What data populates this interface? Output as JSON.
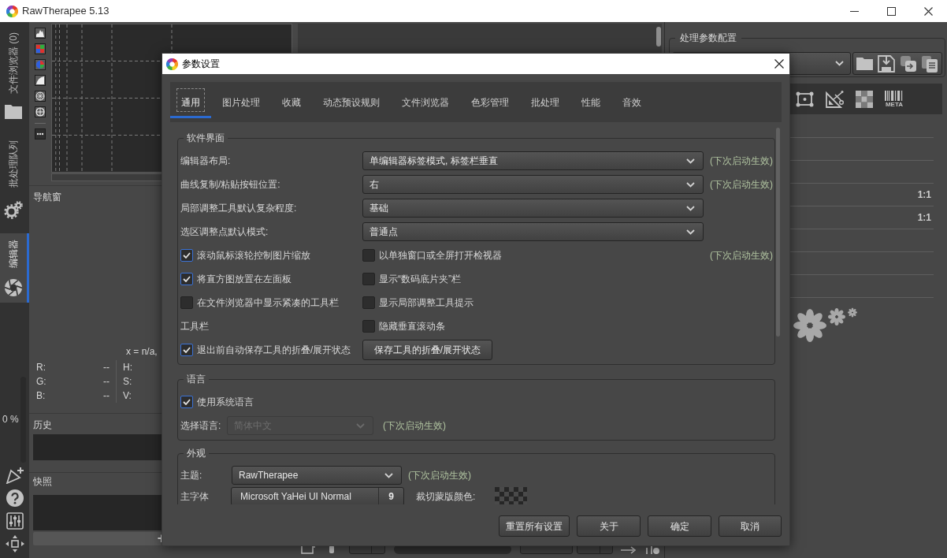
{
  "window": {
    "title": "RawTherapee 5.13"
  },
  "side_tabs": [
    {
      "label": "文件浏览器 (0)",
      "selected": false
    },
    {
      "label": "批处理队列",
      "selected": false
    },
    {
      "label": "编辑器",
      "selected": true
    }
  ],
  "queue_progress": {
    "label": "0 %"
  },
  "left_panel": {
    "navigator": {
      "title": "导航窗",
      "position": "x = n/a,",
      "rgb": [
        {
          "label": "R:",
          "value": "--"
        },
        {
          "label": "G:",
          "value": "--"
        },
        {
          "label": "B:",
          "value": "--"
        }
      ],
      "hsv": [
        {
          "label": "H:"
        },
        {
          "label": "S:"
        },
        {
          "label": "V:"
        }
      ]
    },
    "history": {
      "title": "历史"
    },
    "snapshots": {
      "title": "快照",
      "add_button": "+"
    }
  },
  "right_panel": {
    "profile": {
      "title": "处理参数配置"
    },
    "toolbar": {
      "metadata_label": "META"
    },
    "tool_rows": [
      {
        "kind": "blank"
      },
      {
        "kind": "blank"
      },
      {
        "kind": "blank"
      },
      {
        "kind": "ratio",
        "value": "1:1"
      },
      {
        "kind": "ratio",
        "value": "1:1"
      },
      {
        "kind": "blank"
      },
      {
        "kind": "blank"
      },
      {
        "kind": "blank"
      }
    ]
  },
  "dialog": {
    "title": "参数设置",
    "tabs": [
      {
        "label": "通用",
        "selected": true
      },
      {
        "label": "图片处理",
        "selected": false
      },
      {
        "label": "收藏",
        "selected": false
      },
      {
        "label": "动态预设规则",
        "selected": false
      },
      {
        "label": "文件浏览器",
        "selected": false
      },
      {
        "label": "色彩管理",
        "selected": false
      },
      {
        "label": "批处理",
        "selected": false
      },
      {
        "label": "性能",
        "selected": false
      },
      {
        "label": "音效",
        "selected": false
      }
    ],
    "sections": [
      {
        "title": "软件界面",
        "rows": [
          {
            "kind": "combo",
            "label": "编辑器布局:",
            "value": "单编辑器标签模式, 标签栏垂直",
            "disabled": false,
            "note": "(下次启动生效)"
          },
          {
            "kind": "combo",
            "label": "曲线复制/粘贴按钮位置:",
            "value": "右",
            "disabled": false,
            "note": "(下次启动生效)"
          },
          {
            "kind": "combo",
            "label": "局部调整工具默认复杂程度:",
            "value": "基础",
            "disabled": false
          },
          {
            "kind": "combo",
            "label": "选区调整点默认模式:",
            "value": "普通点",
            "disabled": false
          },
          {
            "kind": "pair",
            "left": {
              "kind": "checkbox",
              "label": "滚动鼠标滚轮控制图片缩放",
              "checked": true
            },
            "right": {
              "kind": "checkbox",
              "label": "以单独窗口或全屏打开检视器",
              "checked": false
            },
            "note": "(下次启动生效)"
          },
          {
            "kind": "pair",
            "left": {
              "kind": "checkbox",
              "label": "将直方图放置在左面板",
              "checked": true
            },
            "right": {
              "kind": "checkbox",
              "label": "显示“数码底片夹”栏",
              "checked": false
            }
          },
          {
            "kind": "pair",
            "left": {
              "kind": "checkbox",
              "label": "在文件浏览器中显示紧凑的工具栏",
              "checked": false
            },
            "right": {
              "kind": "checkbox",
              "label": "显示局部调整工具提示",
              "checked": false
            }
          },
          {
            "kind": "pair",
            "left": {
              "kind": "text",
              "label": "工具栏"
            },
            "right": {
              "kind": "checkbox",
              "label": "隐藏垂直滚动条",
              "checked": false
            }
          },
          {
            "kind": "pair",
            "left": {
              "kind": "checkbox",
              "label": "退出前自动保存工具的折叠/展开状态",
              "checked": true
            },
            "right": {
              "kind": "button",
              "label": "保存工具的折叠/展开状态"
            }
          }
        ]
      },
      {
        "title": "语言",
        "rows": [
          {
            "kind": "pair",
            "left": {
              "kind": "checkbox",
              "label": "使用系统语言",
              "checked": true
            }
          },
          {
            "kind": "combo",
            "label": "选择语言:",
            "value": "简体中文",
            "disabled": true,
            "note": "(下次启动生效)"
          }
        ]
      },
      {
        "title": "外观",
        "rows": [
          {
            "kind": "combo",
            "label": "主题:",
            "value": "RawTherapee",
            "disabled": false,
            "note": "(下次启动生效)"
          },
          {
            "kind": "font",
            "label": "主字体",
            "value": "Microsoft YaHei UI Normal",
            "size": "9",
            "extra_label": "裁切蒙版颜色:"
          }
        ]
      }
    ],
    "buttons": [
      "重置所有设置",
      "关于",
      "确定",
      "取消"
    ]
  }
}
